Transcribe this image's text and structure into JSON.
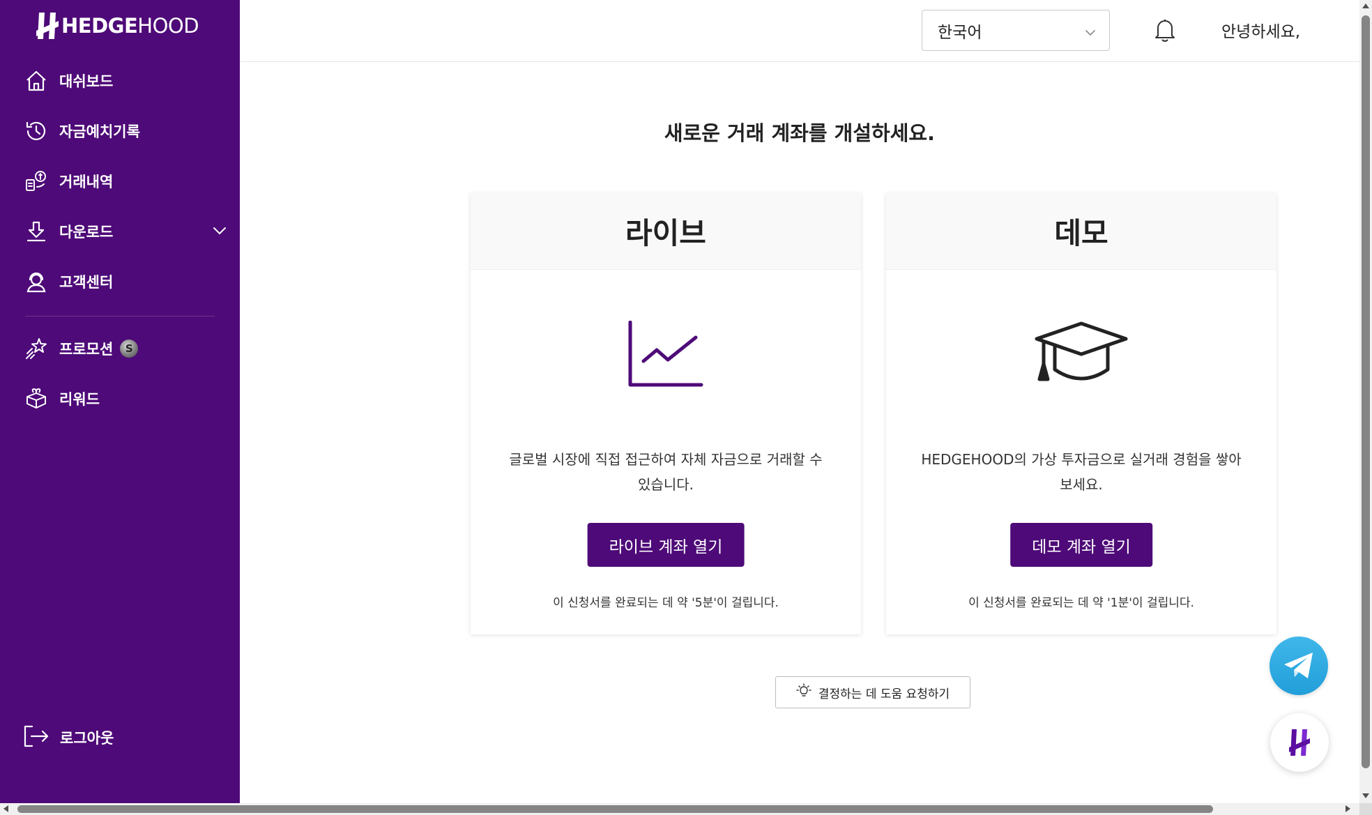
{
  "brand": {
    "name_bold": "HEDGE",
    "name_light": "HOOD",
    "primary_color": "#4e0a78"
  },
  "sidebar": {
    "items": [
      {
        "label": "대쉬보드",
        "icon": "home-icon"
      },
      {
        "label": "자금예치기록",
        "icon": "history-icon"
      },
      {
        "label": "거래내역",
        "icon": "transactions-icon"
      },
      {
        "label": "다운로드",
        "icon": "download-icon",
        "expandable": true
      },
      {
        "label": "고객센터",
        "icon": "support-icon"
      }
    ],
    "secondary_items": [
      {
        "label": "프로모션",
        "icon": "sparkle-star-icon",
        "badge": "S"
      },
      {
        "label": "리워드",
        "icon": "gift-box-icon"
      }
    ],
    "logout_label": "로그아웃"
  },
  "header": {
    "language": "한국어",
    "greeting": "안녕하세요,"
  },
  "main": {
    "title": "새로운 거래 계좌를 개설하세요.",
    "cards": [
      {
        "title": "라이브",
        "icon": "line-chart-icon",
        "description_line1": "글로벌 시장에 직접 접근하여 자체 자금으로 거래할 수",
        "description_line2": "있습니다.",
        "button_label": "라이브 계좌 열기",
        "note": "이 신청서를 완료되는 데 약 '5분'이 걸립니다."
      },
      {
        "title": "데모",
        "icon": "graduation-cap-icon",
        "description_line1": "HEDGEHOOD의 가상 투자금으로 실거래 경험을 쌓아",
        "description_line2": "보세요.",
        "button_label": "데모 계좌 열기",
        "note": "이 신청서를 완료되는 데 약 '1분'이 걸립니다."
      }
    ],
    "help_button_label": "결정하는 데 도움 요청하기"
  }
}
